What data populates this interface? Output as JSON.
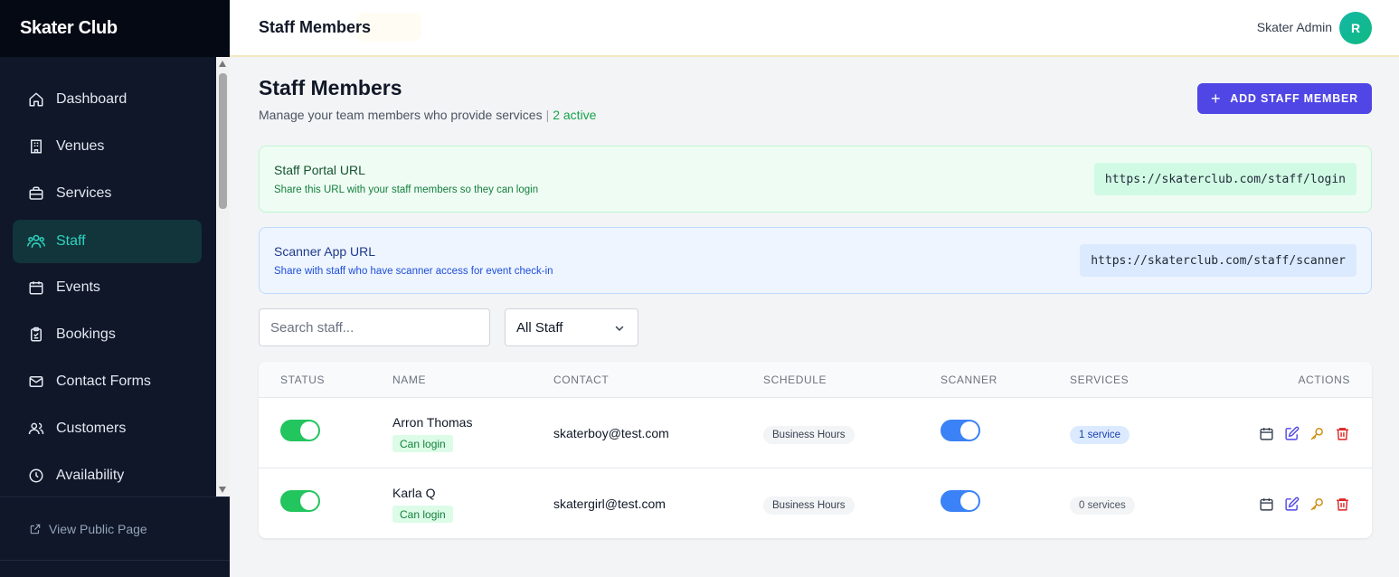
{
  "app": {
    "brand": "Skater Club"
  },
  "sidebar": {
    "items": [
      {
        "label": "Dashboard",
        "icon": "home-icon"
      },
      {
        "label": "Venues",
        "icon": "building-icon"
      },
      {
        "label": "Services",
        "icon": "briefcase-icon"
      },
      {
        "label": "Staff",
        "icon": "users-icon",
        "active": true
      },
      {
        "label": "Events",
        "icon": "calendar-icon"
      },
      {
        "label": "Bookings",
        "icon": "clipboard-icon"
      },
      {
        "label": "Contact Forms",
        "icon": "mail-icon"
      },
      {
        "label": "Customers",
        "icon": "user-group-icon"
      },
      {
        "label": "Availability",
        "icon": "clock-icon"
      }
    ],
    "footer_link": "View Public Page"
  },
  "header": {
    "title": "Staff Members",
    "user_name": "Skater Admin",
    "avatar_initial": "R"
  },
  "page": {
    "title": "Staff Members",
    "subtitle": "Manage your team members who provide services",
    "separator": "|",
    "active_count": "2 active",
    "add_button": "ADD STAFF MEMBER"
  },
  "portal": {
    "title": "Staff Portal URL",
    "desc": "Share this URL with your staff members so they can login",
    "url": "https://skaterclub.com/staff/login"
  },
  "scanner": {
    "title": "Scanner App URL",
    "desc": "Share with staff who have scanner access for event check-in",
    "url": "https://skaterclub.com/staff/scanner"
  },
  "filters": {
    "search_placeholder": "Search staff...",
    "select_value": "All Staff"
  },
  "table": {
    "headers": {
      "status": "STATUS",
      "name": "NAME",
      "contact": "CONTACT",
      "schedule": "SCHEDULE",
      "scanner": "SCANNER",
      "services": "SERVICES",
      "actions": "ACTIONS"
    },
    "rows": [
      {
        "name": "Arron Thomas",
        "badge": "Can login",
        "email": "skaterboy@test.com",
        "schedule": "Business Hours",
        "services": "1 service",
        "status_on": true,
        "scanner_on": true
      },
      {
        "name": "Karla Q",
        "badge": "Can login",
        "email": "skatergirl@test.com",
        "schedule": "Business Hours",
        "services": "0 services",
        "status_on": true,
        "scanner_on": true
      }
    ]
  },
  "colors": {
    "sidebar_bg": "#0f1729",
    "active_accent": "#2dd4bf",
    "primary": "#4f46e5",
    "success": "#22c55e",
    "scanner_toggle": "#3b82f6",
    "delete": "#dc2626",
    "key": "#ca8a04"
  }
}
